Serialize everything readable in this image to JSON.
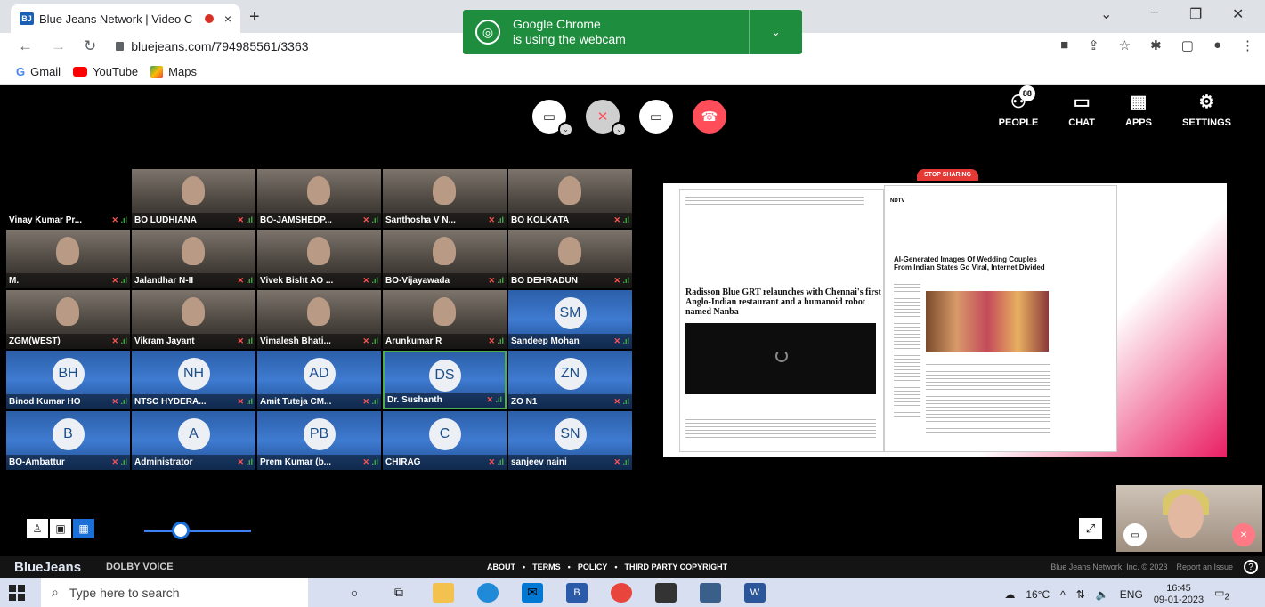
{
  "browser": {
    "tab_title": "Blue Jeans Network | Video C",
    "tab_close": "×",
    "new_tab": "+",
    "url": "bluejeans.com/794985561/3363",
    "win_min": "−",
    "win_max": "❐",
    "win_close": "✕",
    "tab_dropdown": "⌄",
    "bookmarks": [
      {
        "label": "Gmail"
      },
      {
        "label": "YouTube"
      },
      {
        "label": "Maps"
      }
    ],
    "notification": {
      "title": "Google Chrome",
      "text": "is using the webcam"
    }
  },
  "toolbar": {
    "items": [
      {
        "label": "PEOPLE",
        "icon": "people-icon",
        "badge": "88"
      },
      {
        "label": "CHAT",
        "icon": "chat-icon"
      },
      {
        "label": "APPS",
        "icon": "apps-icon"
      },
      {
        "label": "SETTINGS",
        "icon": "settings-icon"
      }
    ]
  },
  "participants": [
    {
      "name": "Vinay Kumar Pr...",
      "kind": "black"
    },
    {
      "name": "BO LUDHIANA",
      "kind": "photo"
    },
    {
      "name": "BO-JAMSHEDP...",
      "kind": "photo"
    },
    {
      "name": "Santhosha V N...",
      "kind": "photo"
    },
    {
      "name": "BO KOLKATA",
      "kind": "photo"
    },
    {
      "name": "M.",
      "kind": "photo"
    },
    {
      "name": "Jalandhar N-II",
      "kind": "photo"
    },
    {
      "name": "Vivek Bisht AO ...",
      "kind": "photo"
    },
    {
      "name": "BO-Vijayawada",
      "kind": "photo"
    },
    {
      "name": "BO DEHRADUN",
      "kind": "photo"
    },
    {
      "name": "ZGM(WEST)",
      "kind": "photo"
    },
    {
      "name": "Vikram Jayant",
      "kind": "photo"
    },
    {
      "name": "Vimalesh Bhati...",
      "kind": "photo"
    },
    {
      "name": "Arunkumar R",
      "kind": "photo"
    },
    {
      "name": "Sandeep Mohan",
      "kind": "avatar",
      "initials": "SM"
    },
    {
      "name": "Binod Kumar HO",
      "kind": "avatar",
      "initials": "BH"
    },
    {
      "name": "NTSC HYDERA...",
      "kind": "avatar",
      "initials": "NH"
    },
    {
      "name": "Amit Tuteja CM...",
      "kind": "avatar",
      "initials": "AD"
    },
    {
      "name": "Dr. Sushanth",
      "kind": "avatar",
      "initials": "DS",
      "active": true
    },
    {
      "name": "ZO N1",
      "kind": "avatar",
      "initials": "ZN"
    },
    {
      "name": "BO-Ambattur",
      "kind": "avatar",
      "initials": "B"
    },
    {
      "name": "Administrator",
      "kind": "avatar",
      "initials": "A"
    },
    {
      "name": "Prem Kumar (b...",
      "kind": "avatar",
      "initials": "PB"
    },
    {
      "name": "CHIRAG",
      "kind": "avatar",
      "initials": "C"
    },
    {
      "name": "sanjeev naini",
      "kind": "avatar",
      "initials": "SN"
    }
  ],
  "share": {
    "stop_label": "STOP SHARING",
    "left_headline": "Radisson Blue GRT relaunches with Chennai's first Anglo-Indian restaurant and a humanoid robot named Nanba",
    "right_brand": "NDTV",
    "right_headline": "AI-Generated Images Of Wedding Couples From Indian States Go Viral, Internet Divided"
  },
  "footer": {
    "brand": "BlueJeans",
    "dolby": "DOLBY VOICE",
    "links": [
      "ABOUT",
      "TERMS",
      "POLICY",
      "THIRD PARTY COPYRIGHT"
    ],
    "copyright": "Blue Jeans Network, Inc. © 2023",
    "report": "Report an Issue"
  },
  "taskbar": {
    "search_placeholder": "Type here to search",
    "temperature": "16°C",
    "lang": "ENG",
    "time": "16:45",
    "date": "09-01-2023",
    "notif_count": "2"
  },
  "colors": {
    "accent": "#1b6fd9",
    "hangup": "#ff4d5a",
    "notification": "#1e8e3e"
  }
}
